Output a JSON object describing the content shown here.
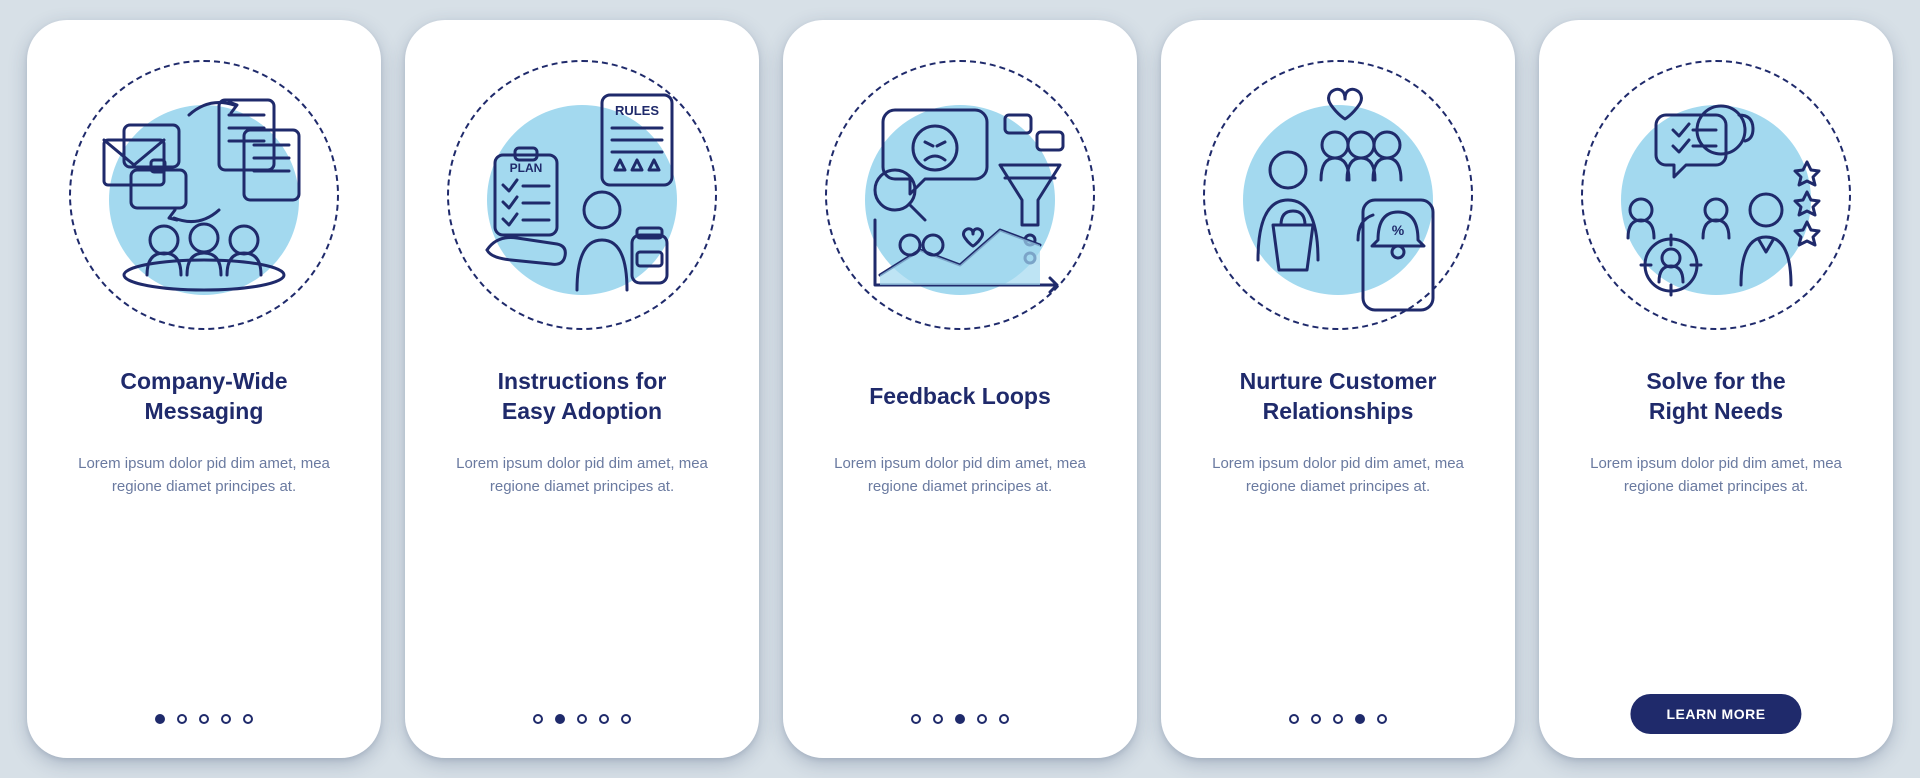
{
  "colors": {
    "bg": "#d7e0e7",
    "navy": "#1f2a6b",
    "sky": "#a3d9ef",
    "yellow": "#ffd447",
    "red": "#f08a8a",
    "text": "#6a7aa0"
  },
  "cta_label": "LEARN MORE",
  "screens": [
    {
      "icon": "company-messaging",
      "title": "Company-Wide\nMessaging",
      "desc": "Lorem ipsum dolor pid dim amet, mea regione diamet principes at.",
      "active_dot": 0,
      "show_cta": false,
      "page_count": 5
    },
    {
      "icon": "easy-adoption",
      "title": "Instructions for\nEasy Adoption",
      "desc": "Lorem ipsum dolor pid dim amet, mea regione diamet principes at.",
      "active_dot": 1,
      "show_cta": false,
      "page_count": 5
    },
    {
      "icon": "feedback-loops",
      "title": "Feedback Loops",
      "desc": "Lorem ipsum dolor pid dim amet, mea regione diamet principes at.",
      "active_dot": 2,
      "show_cta": false,
      "page_count": 5
    },
    {
      "icon": "nurture-relationships",
      "title": "Nurture Customer\nRelationships",
      "desc": "Lorem ipsum dolor pid dim amet, mea regione diamet principes at.",
      "active_dot": 3,
      "show_cta": false,
      "page_count": 5
    },
    {
      "icon": "right-needs",
      "title": "Solve for the\nRight Needs",
      "desc": "Lorem ipsum dolor pid dim amet, mea regione diamet principes at.",
      "active_dot": 4,
      "show_cta": true,
      "page_count": 5
    }
  ]
}
